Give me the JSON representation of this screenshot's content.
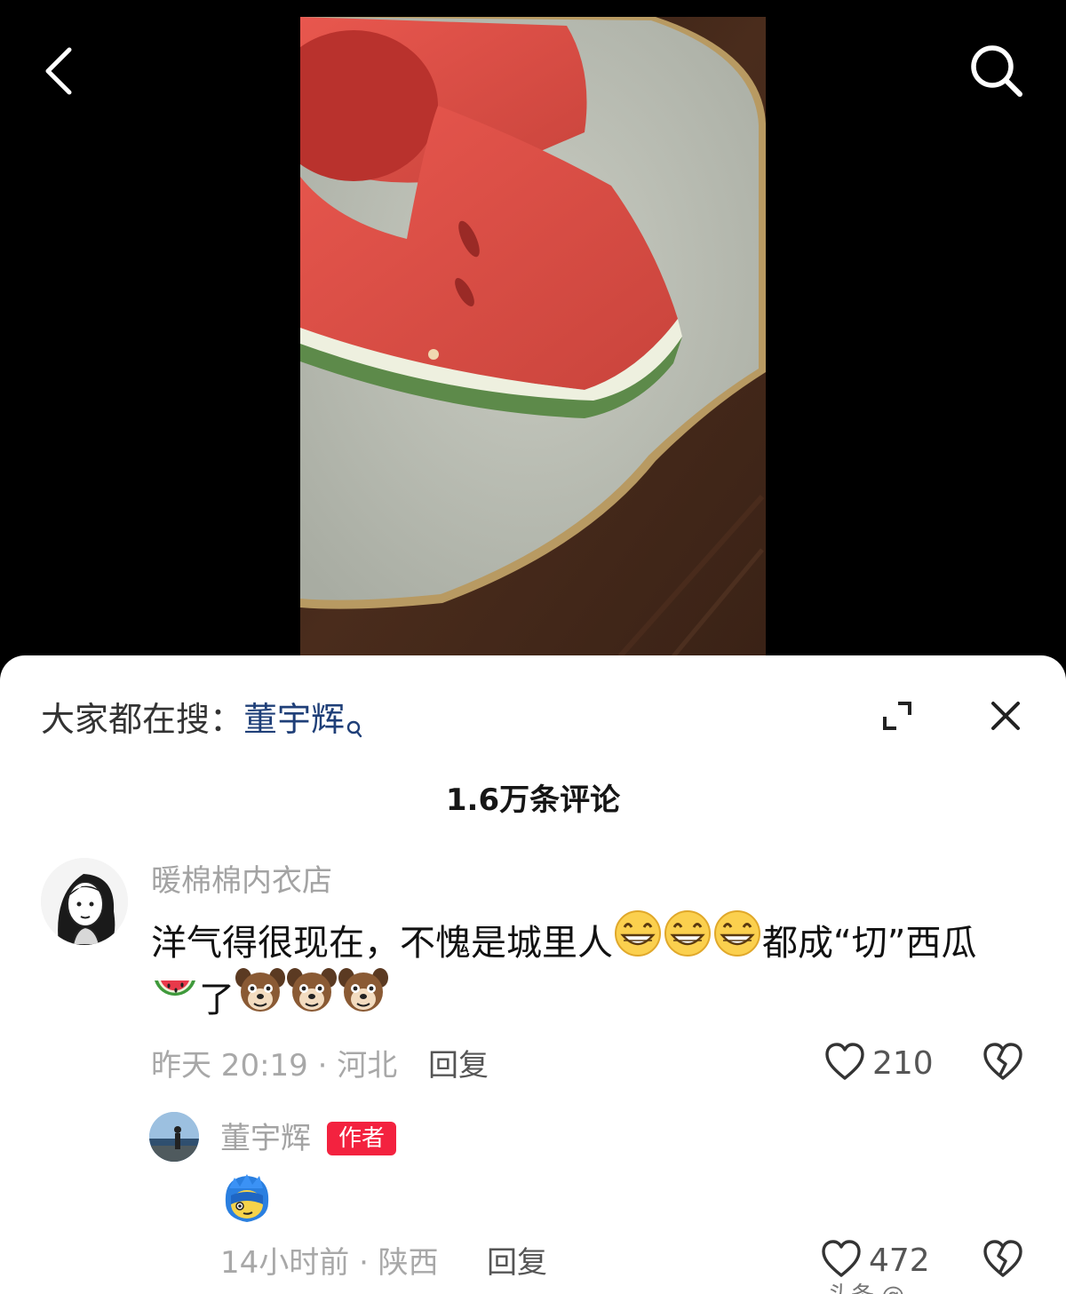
{
  "topbar": {
    "back_icon": "chevron-left-icon",
    "search_icon": "search-icon"
  },
  "video": {
    "subject": "watermelon slices on plate"
  },
  "sheet": {
    "trending_prefix": "大家都在搜：",
    "trending_keyword": "董宇辉",
    "comment_count": "1.6万条评论",
    "expand_icon": "expand-icon",
    "close_icon": "close-icon"
  },
  "comments": [
    {
      "username": "暖棉棉内衣店",
      "text_part1": "洋气得很现在，不愧是城里人",
      "text_part2": "都成“切”西瓜",
      "text_part3": "了",
      "emojis": [
        "grin-emoji",
        "grin-emoji",
        "grin-emoji",
        "watermelon-emoji",
        "dog-emoji",
        "dog-emoji",
        "dog-emoji"
      ],
      "time_location": "昨天 20:19 · 河北",
      "reply_label": "回复",
      "likes": "210"
    },
    {
      "username": "董宇辉",
      "author_tag": "作者",
      "sticker": "blue-hair-sticker",
      "time_location": "14小时前 · 陕西",
      "reply_label": "回复",
      "likes": "472"
    }
  ],
  "colors": {
    "keyword": "#1f3f78",
    "author_tag": "#f3223f",
    "meta_text": "#a8a8a8"
  },
  "watermark": "头条 @"
}
